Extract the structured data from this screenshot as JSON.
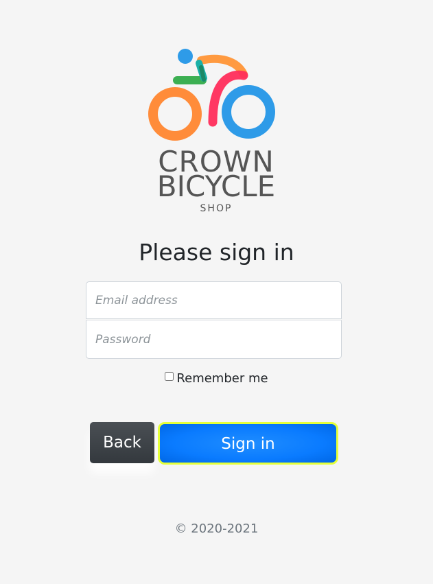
{
  "logo": {
    "line1": "CROWN",
    "line2": "BICYCLE",
    "line3": "SHOP",
    "colors": {
      "orange": "#ff8c3a",
      "blue": "#2e9be8",
      "pink": "#ff2d5b",
      "green": "#3caf52",
      "teal": "#1ab0a8",
      "text": "#555555"
    }
  },
  "form": {
    "heading": "Please sign in",
    "email_placeholder": "Email address",
    "password_placeholder": "Password",
    "remember_label": "Remember me",
    "remember_checked": false
  },
  "buttons": {
    "back_label": "Back",
    "signin_label": "Sign in",
    "signin_color": "#007bff",
    "back_color": "#343a40"
  },
  "footer": {
    "copyright": "© 2020-2021"
  }
}
